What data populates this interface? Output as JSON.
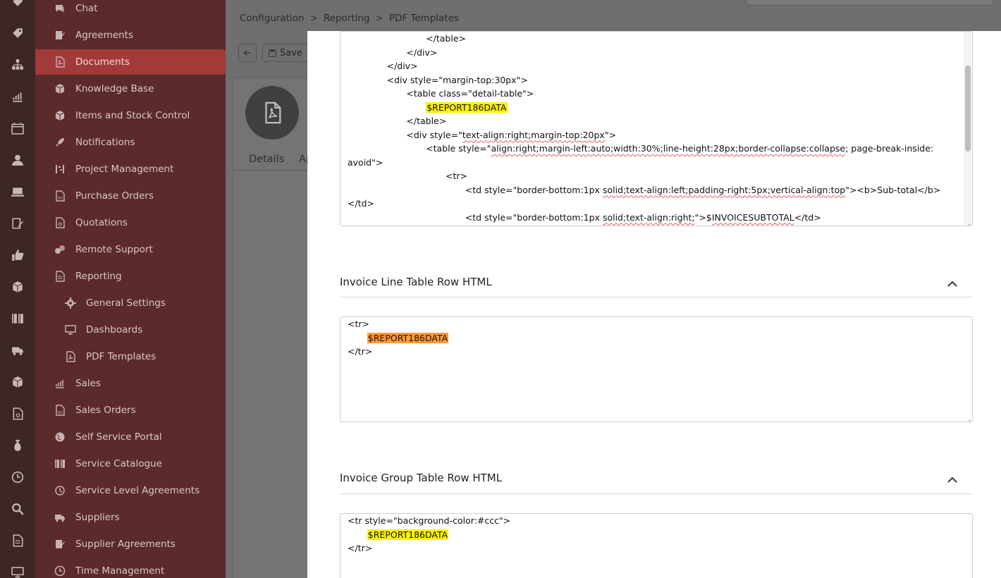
{
  "breadcrumb": [
    "Configuration",
    "Reporting",
    "PDF Templates"
  ],
  "toolbar": {
    "save_label": "Save"
  },
  "record_tabs": [
    "Details",
    "Ap"
  ],
  "sidebar": {
    "items": [
      {
        "label": "Chat",
        "icon": "chat-icon"
      },
      {
        "label": "Agreements",
        "icon": "agreement-icon"
      },
      {
        "label": "Documents",
        "icon": "pdf-document-icon",
        "active": true
      },
      {
        "label": "Knowledge Base",
        "icon": "box-icon"
      },
      {
        "label": "Items and Stock Control",
        "icon": "box-icon"
      },
      {
        "label": "Notifications",
        "icon": "rocket-icon"
      },
      {
        "label": "Project Management",
        "icon": "project-icon"
      },
      {
        "label": "Purchase Orders",
        "icon": "po-document-icon"
      },
      {
        "label": "Quotations",
        "icon": "quote-document-icon"
      },
      {
        "label": "Remote Support",
        "icon": "remote-icon"
      },
      {
        "label": "Reporting",
        "icon": "report-document-icon"
      },
      {
        "label": "General Settings",
        "icon": "gear-icon",
        "sub": true
      },
      {
        "label": "Dashboards",
        "icon": "monitor-icon",
        "sub": true
      },
      {
        "label": "PDF Templates",
        "icon": "pdf-document-icon",
        "sub": true
      },
      {
        "label": "Sales",
        "icon": "chart-icon"
      },
      {
        "label": "Sales Orders",
        "icon": "so-document-icon"
      },
      {
        "label": "Self Service Portal",
        "icon": "globe-icon"
      },
      {
        "label": "Service Catalogue",
        "icon": "book-icon"
      },
      {
        "label": "Service Level Agreements",
        "icon": "sla-icon"
      },
      {
        "label": "Suppliers",
        "icon": "truck-icon"
      },
      {
        "label": "Supplier Agreements",
        "icon": "agreement-icon"
      },
      {
        "label": "Time Management",
        "icon": "clock-icon"
      }
    ]
  },
  "editor_main": {
    "lines": [
      {
        "indent": 4,
        "parts": [
          {
            "t": "</table>"
          }
        ]
      },
      {
        "indent": 3,
        "parts": [
          {
            "t": "</div>"
          }
        ]
      },
      {
        "indent": 2,
        "parts": [
          {
            "t": "</div>"
          }
        ]
      },
      {
        "indent": 2,
        "parts": [
          {
            "t": "<div style=\"margin-top:30px\">"
          }
        ]
      },
      {
        "indent": 3,
        "parts": [
          {
            "t": "<table class=\"detail-table\">"
          }
        ]
      },
      {
        "indent": 4,
        "parts": [
          {
            "t": "$REPORT186DATA",
            "hl": "y"
          }
        ]
      },
      {
        "indent": 3,
        "parts": [
          {
            "t": "</table>"
          }
        ]
      },
      {
        "indent": 3,
        "parts": [
          {
            "t": "<div style=\""
          },
          {
            "t": "text-align:right;margin-top:20px",
            "sq": true
          },
          {
            "t": "\">"
          }
        ]
      },
      {
        "indent": 4,
        "parts": [
          {
            "t": "<table style=\""
          },
          {
            "t": "align:right;margin-left:auto;width:30%;line-height:28px;border-collapse:collapse",
            "sq": true
          },
          {
            "t": "; page-break-inside:"
          }
        ]
      },
      {
        "indent": 0,
        "parts": [
          {
            "t": "avoid\">"
          }
        ]
      },
      {
        "indent": 5,
        "parts": [
          {
            "t": "<tr>"
          }
        ]
      },
      {
        "indent": 6,
        "parts": [
          {
            "t": "<td style=\"border-bottom:1px "
          },
          {
            "t": "solid;text-align:left;padding-right:5px;vertical-align:top",
            "sq": true
          },
          {
            "t": "\"><b>Sub-total</b>"
          }
        ]
      },
      {
        "indent": 0,
        "parts": [
          {
            "t": "</td>"
          }
        ]
      },
      {
        "indent": 6,
        "parts": [
          {
            "t": "<td style=\"border-bottom:1px "
          },
          {
            "t": "solid;text-align:right;",
            "sq": true
          },
          {
            "t": "\">$"
          },
          {
            "t": "INVOICESUBTOTAL",
            "sq": true
          },
          {
            "t": "</td>"
          }
        ]
      }
    ]
  },
  "section_line_row": {
    "title": "Invoice Line Table Row HTML",
    "lines": [
      {
        "indent": 0,
        "parts": [
          {
            "t": "<tr>"
          }
        ]
      },
      {
        "indent": 1,
        "parts": [
          {
            "t": "$REPORT186DATA",
            "hl": "o"
          }
        ]
      },
      {
        "indent": 0,
        "parts": [
          {
            "t": "</tr>"
          }
        ]
      }
    ]
  },
  "section_group_row": {
    "title": "Invoice Group Table Row HTML",
    "lines": [
      {
        "indent": 0,
        "parts": [
          {
            "t": "<tr style=\"background-color:#ccc\">"
          }
        ]
      },
      {
        "indent": 1,
        "parts": [
          {
            "t": "$REPORT186DATA",
            "hl": "y"
          }
        ]
      },
      {
        "indent": 0,
        "parts": [
          {
            "t": "</tr>"
          }
        ]
      }
    ]
  }
}
